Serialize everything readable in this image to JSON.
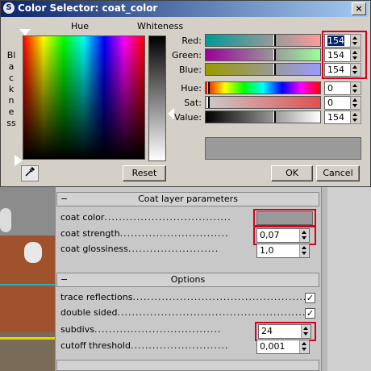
{
  "window": {
    "title": "Color Selector: coat_color",
    "close_glyph": "×"
  },
  "picker": {
    "hue_label": "Hue",
    "whiteness_label": "Whiteness",
    "blackness_label": "Blackness"
  },
  "channels": [
    {
      "label": "Red:",
      "value": "154"
    },
    {
      "label": "Green:",
      "value": "154"
    },
    {
      "label": "Blue:",
      "value": "154"
    },
    {
      "label": "Hue:",
      "value": "0"
    },
    {
      "label": "Sat:",
      "value": "0"
    },
    {
      "label": "Value:",
      "value": "154"
    }
  ],
  "swatch_color": "#9a9a9a",
  "buttons": {
    "reset": "Reset",
    "ok": "OK",
    "cancel": "Cancel"
  },
  "rollout": {
    "coat_group": {
      "title": "Coat layer parameters",
      "minus": "−",
      "rows": [
        {
          "label": "coat color",
          "dots": "..................................."
        },
        {
          "label": "coat strength",
          "dots": "..............................",
          "value": "0,07"
        },
        {
          "label": "coat glossiness",
          "dots": ".........................",
          "value": "1,0"
        }
      ]
    },
    "options_group": {
      "title": "Options",
      "minus": "−",
      "rows": [
        {
          "label": "trace reflections",
          "dots": "................................................",
          "checked": "✓"
        },
        {
          "label": "double sided",
          "dots": ".......................................................",
          "checked": "✓"
        },
        {
          "label": "subdivs",
          "dots": "...................................",
          "value": "24"
        },
        {
          "label": "cutoff threshold",
          "dots": "...........................",
          "value": "0,001"
        }
      ]
    }
  },
  "colors": {
    "highlight": "#d8001c",
    "titlebar": "#0a246a"
  }
}
